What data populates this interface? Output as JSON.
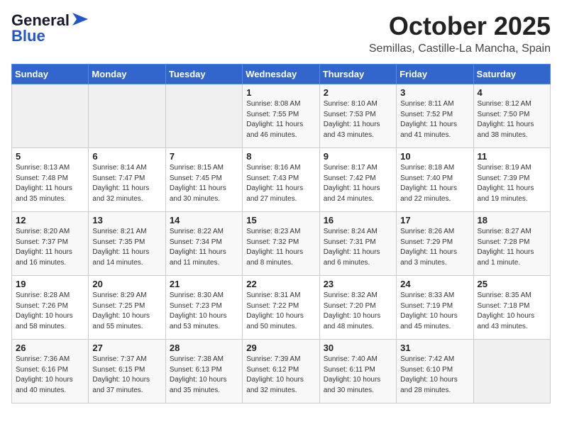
{
  "header": {
    "logo_line1": "General",
    "logo_line2": "Blue",
    "month": "October 2025",
    "location": "Semillas, Castille-La Mancha, Spain"
  },
  "weekdays": [
    "Sunday",
    "Monday",
    "Tuesday",
    "Wednesday",
    "Thursday",
    "Friday",
    "Saturday"
  ],
  "weeks": [
    [
      {
        "day": "",
        "info": ""
      },
      {
        "day": "",
        "info": ""
      },
      {
        "day": "",
        "info": ""
      },
      {
        "day": "1",
        "info": "Sunrise: 8:08 AM\nSunset: 7:55 PM\nDaylight: 11 hours\nand 46 minutes."
      },
      {
        "day": "2",
        "info": "Sunrise: 8:10 AM\nSunset: 7:53 PM\nDaylight: 11 hours\nand 43 minutes."
      },
      {
        "day": "3",
        "info": "Sunrise: 8:11 AM\nSunset: 7:52 PM\nDaylight: 11 hours\nand 41 minutes."
      },
      {
        "day": "4",
        "info": "Sunrise: 8:12 AM\nSunset: 7:50 PM\nDaylight: 11 hours\nand 38 minutes."
      }
    ],
    [
      {
        "day": "5",
        "info": "Sunrise: 8:13 AM\nSunset: 7:48 PM\nDaylight: 11 hours\nand 35 minutes."
      },
      {
        "day": "6",
        "info": "Sunrise: 8:14 AM\nSunset: 7:47 PM\nDaylight: 11 hours\nand 32 minutes."
      },
      {
        "day": "7",
        "info": "Sunrise: 8:15 AM\nSunset: 7:45 PM\nDaylight: 11 hours\nand 30 minutes."
      },
      {
        "day": "8",
        "info": "Sunrise: 8:16 AM\nSunset: 7:43 PM\nDaylight: 11 hours\nand 27 minutes."
      },
      {
        "day": "9",
        "info": "Sunrise: 8:17 AM\nSunset: 7:42 PM\nDaylight: 11 hours\nand 24 minutes."
      },
      {
        "day": "10",
        "info": "Sunrise: 8:18 AM\nSunset: 7:40 PM\nDaylight: 11 hours\nand 22 minutes."
      },
      {
        "day": "11",
        "info": "Sunrise: 8:19 AM\nSunset: 7:39 PM\nDaylight: 11 hours\nand 19 minutes."
      }
    ],
    [
      {
        "day": "12",
        "info": "Sunrise: 8:20 AM\nSunset: 7:37 PM\nDaylight: 11 hours\nand 16 minutes."
      },
      {
        "day": "13",
        "info": "Sunrise: 8:21 AM\nSunset: 7:35 PM\nDaylight: 11 hours\nand 14 minutes."
      },
      {
        "day": "14",
        "info": "Sunrise: 8:22 AM\nSunset: 7:34 PM\nDaylight: 11 hours\nand 11 minutes."
      },
      {
        "day": "15",
        "info": "Sunrise: 8:23 AM\nSunset: 7:32 PM\nDaylight: 11 hours\nand 8 minutes."
      },
      {
        "day": "16",
        "info": "Sunrise: 8:24 AM\nSunset: 7:31 PM\nDaylight: 11 hours\nand 6 minutes."
      },
      {
        "day": "17",
        "info": "Sunrise: 8:26 AM\nSunset: 7:29 PM\nDaylight: 11 hours\nand 3 minutes."
      },
      {
        "day": "18",
        "info": "Sunrise: 8:27 AM\nSunset: 7:28 PM\nDaylight: 11 hours\nand 1 minute."
      }
    ],
    [
      {
        "day": "19",
        "info": "Sunrise: 8:28 AM\nSunset: 7:26 PM\nDaylight: 10 hours\nand 58 minutes."
      },
      {
        "day": "20",
        "info": "Sunrise: 8:29 AM\nSunset: 7:25 PM\nDaylight: 10 hours\nand 55 minutes."
      },
      {
        "day": "21",
        "info": "Sunrise: 8:30 AM\nSunset: 7:23 PM\nDaylight: 10 hours\nand 53 minutes."
      },
      {
        "day": "22",
        "info": "Sunrise: 8:31 AM\nSunset: 7:22 PM\nDaylight: 10 hours\nand 50 minutes."
      },
      {
        "day": "23",
        "info": "Sunrise: 8:32 AM\nSunset: 7:20 PM\nDaylight: 10 hours\nand 48 minutes."
      },
      {
        "day": "24",
        "info": "Sunrise: 8:33 AM\nSunset: 7:19 PM\nDaylight: 10 hours\nand 45 minutes."
      },
      {
        "day": "25",
        "info": "Sunrise: 8:35 AM\nSunset: 7:18 PM\nDaylight: 10 hours\nand 43 minutes."
      }
    ],
    [
      {
        "day": "26",
        "info": "Sunrise: 7:36 AM\nSunset: 6:16 PM\nDaylight: 10 hours\nand 40 minutes."
      },
      {
        "day": "27",
        "info": "Sunrise: 7:37 AM\nSunset: 6:15 PM\nDaylight: 10 hours\nand 37 minutes."
      },
      {
        "day": "28",
        "info": "Sunrise: 7:38 AM\nSunset: 6:13 PM\nDaylight: 10 hours\nand 35 minutes."
      },
      {
        "day": "29",
        "info": "Sunrise: 7:39 AM\nSunset: 6:12 PM\nDaylight: 10 hours\nand 32 minutes."
      },
      {
        "day": "30",
        "info": "Sunrise: 7:40 AM\nSunset: 6:11 PM\nDaylight: 10 hours\nand 30 minutes."
      },
      {
        "day": "31",
        "info": "Sunrise: 7:42 AM\nSunset: 6:10 PM\nDaylight: 10 hours\nand 28 minutes."
      },
      {
        "day": "",
        "info": ""
      }
    ]
  ]
}
